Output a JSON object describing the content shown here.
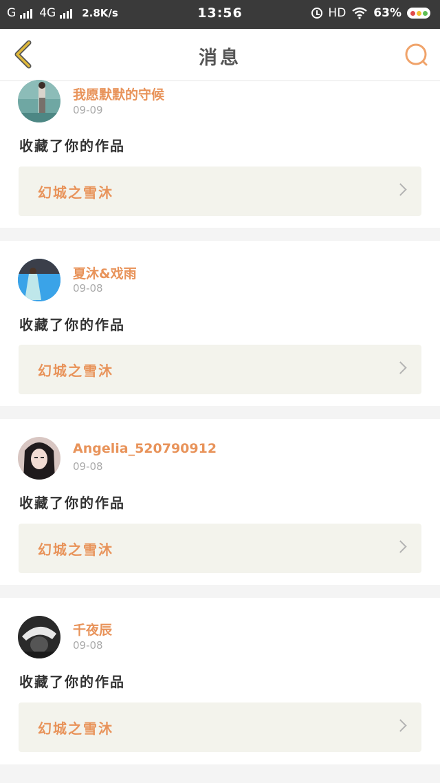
{
  "status_bar": {
    "carrier": "G",
    "network": "4G",
    "speed": "2.8K/s",
    "time": "13:56",
    "hd": "HD",
    "battery": "63%"
  },
  "header": {
    "title": "消息",
    "back_icon": "chevron-left-icon",
    "search_icon": "search-icon"
  },
  "colors": {
    "accent": "#e8935a",
    "back_icon": "#e0b93a",
    "text_dark": "#333333",
    "date": "#aaaaaa",
    "work_box_bg": "#f3f3ec"
  },
  "messages": [
    {
      "user": "我愿默默的守候",
      "date": "09-09",
      "action": "收藏了你的作品",
      "work": "幻城之雪沐"
    },
    {
      "user": "夏沐&戏雨",
      "date": "09-08",
      "action": "收藏了你的作品",
      "work": "幻城之雪沐"
    },
    {
      "user": "Angelia_520790912",
      "date": "09-08",
      "action": "收藏了你的作品",
      "work": "幻城之雪沐"
    },
    {
      "user": "千夜辰",
      "date": "09-08",
      "action": "收藏了你的作品",
      "work": "幻城之雪沐"
    }
  ]
}
